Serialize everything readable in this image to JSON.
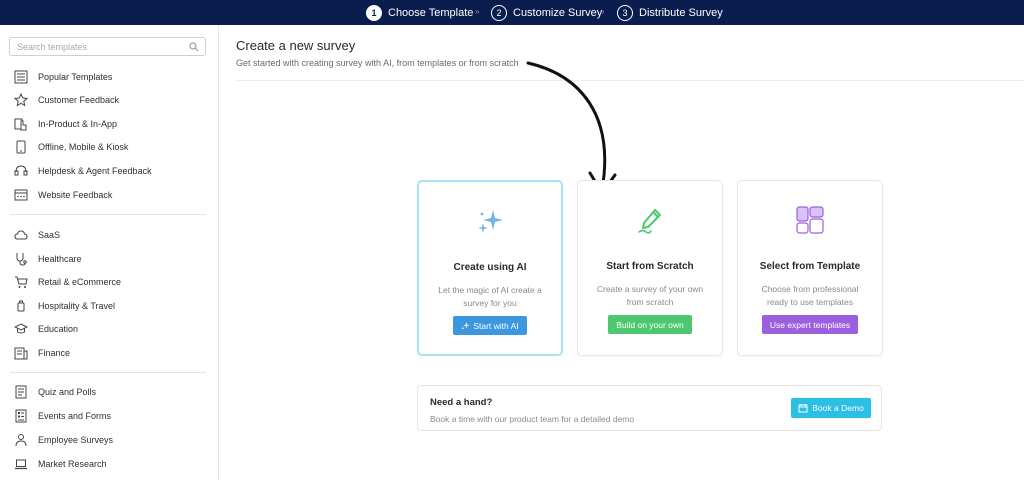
{
  "stepper": {
    "steps": [
      {
        "num": "1",
        "label": "Choose Template",
        "active": true
      },
      {
        "num": "2",
        "label": "Customize Survey",
        "active": false
      },
      {
        "num": "3",
        "label": "Distribute Survey",
        "active": false
      }
    ],
    "separator": "»"
  },
  "sidebar": {
    "search_placeholder": "Search templates",
    "groups": [
      [
        {
          "label": "Popular Templates",
          "icon": "grid-list-icon"
        },
        {
          "label": "Customer Feedback",
          "icon": "star-icon"
        },
        {
          "label": "In-Product & In-App",
          "icon": "tap-icon"
        },
        {
          "label": "Offline, Mobile & Kiosk",
          "icon": "tablet-icon"
        },
        {
          "label": "Helpdesk & Agent Feedback",
          "icon": "headset-icon"
        },
        {
          "label": "Website Feedback",
          "icon": "browser-icon"
        }
      ],
      [
        {
          "label": "SaaS",
          "icon": "cloud-icon"
        },
        {
          "label": "Healthcare",
          "icon": "stethoscope-icon"
        },
        {
          "label": "Retail & eCommerce",
          "icon": "cart-icon"
        },
        {
          "label": "Hospitality & Travel",
          "icon": "luggage-icon"
        },
        {
          "label": "Education",
          "icon": "graduation-cap-icon"
        },
        {
          "label": "Finance",
          "icon": "finance-icon"
        }
      ],
      [
        {
          "label": "Quiz and Polls",
          "icon": "quiz-icon"
        },
        {
          "label": "Events and Forms",
          "icon": "form-icon"
        },
        {
          "label": "Employee Surveys",
          "icon": "employee-icon"
        },
        {
          "label": "Market Research",
          "icon": "laptop-icon"
        }
      ]
    ]
  },
  "main": {
    "title": "Create a new survey",
    "subtitle": "Get started with creating survey with AI, from templates or from scratch",
    "cards": [
      {
        "title": "Create using AI",
        "desc1": "Let the magic of AI create a",
        "desc2": "survey for you",
        "button": "Start with AI",
        "icon": "sparkle-icon",
        "color": "#3d97de"
      },
      {
        "title": "Start from Scratch",
        "desc1": "Create a survey of your own",
        "desc2": "from scratch",
        "button": "Build on your own",
        "icon": "pen-icon",
        "color": "#4dc86e"
      },
      {
        "title": "Select from Template",
        "desc1": "Choose from professional",
        "desc2": "ready to use templates",
        "button": "Use expert templates",
        "icon": "template-grid-icon",
        "color": "#9b5fe0"
      }
    ],
    "help": {
      "title": "Need a hand?",
      "subtitle": "Book a time with our product team for a detailed demo",
      "button": "Book a Demo",
      "button_color": "#2bbfe6"
    }
  },
  "colors": {
    "topbar": "#0b1d4f",
    "accent_selected_border": "#a7e4f1"
  }
}
